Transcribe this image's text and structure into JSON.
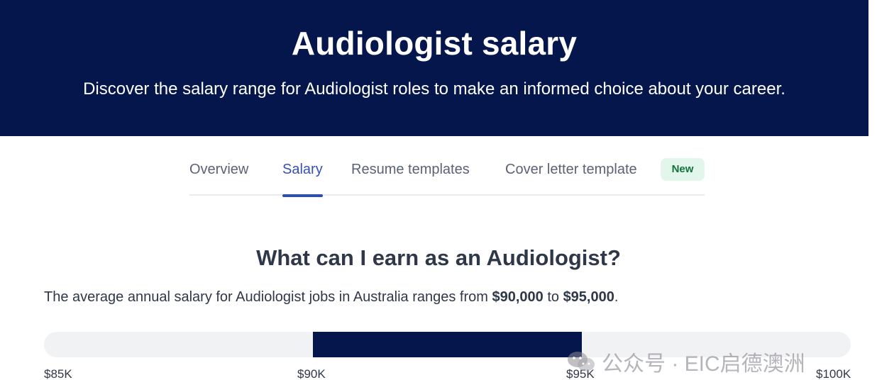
{
  "hero": {
    "title": "Audiologist salary",
    "subtitle": "Discover the salary range for Audiologist roles to make an informed choice about your career."
  },
  "tabs": [
    {
      "label": "Overview",
      "active": false
    },
    {
      "label": "Salary",
      "active": true
    },
    {
      "label": "Resume templates",
      "active": false
    },
    {
      "label": "Cover letter template",
      "active": false
    }
  ],
  "badge": "New",
  "section": {
    "title": "What can I earn as an Audiologist?",
    "summary_prefix": "The average annual salary for Audiologist jobs in Australia ranges from ",
    "low_value": "$90,000",
    "summary_mid": " to ",
    "high_value": "$95,000",
    "summary_suffix": "."
  },
  "salary_range": {
    "axis_min": 85000,
    "axis_max": 100000,
    "range_low": 90000,
    "range_high": 95000,
    "ticks": [
      "$85K",
      "$90K",
      "$95K",
      "$100K"
    ]
  },
  "watermark": "公众号 · EIC启德澳洲",
  "colors": {
    "navy": "#05164d",
    "accent_blue": "#2f4db1",
    "badge_bg": "#e2f6ec",
    "badge_text": "#14733b"
  }
}
